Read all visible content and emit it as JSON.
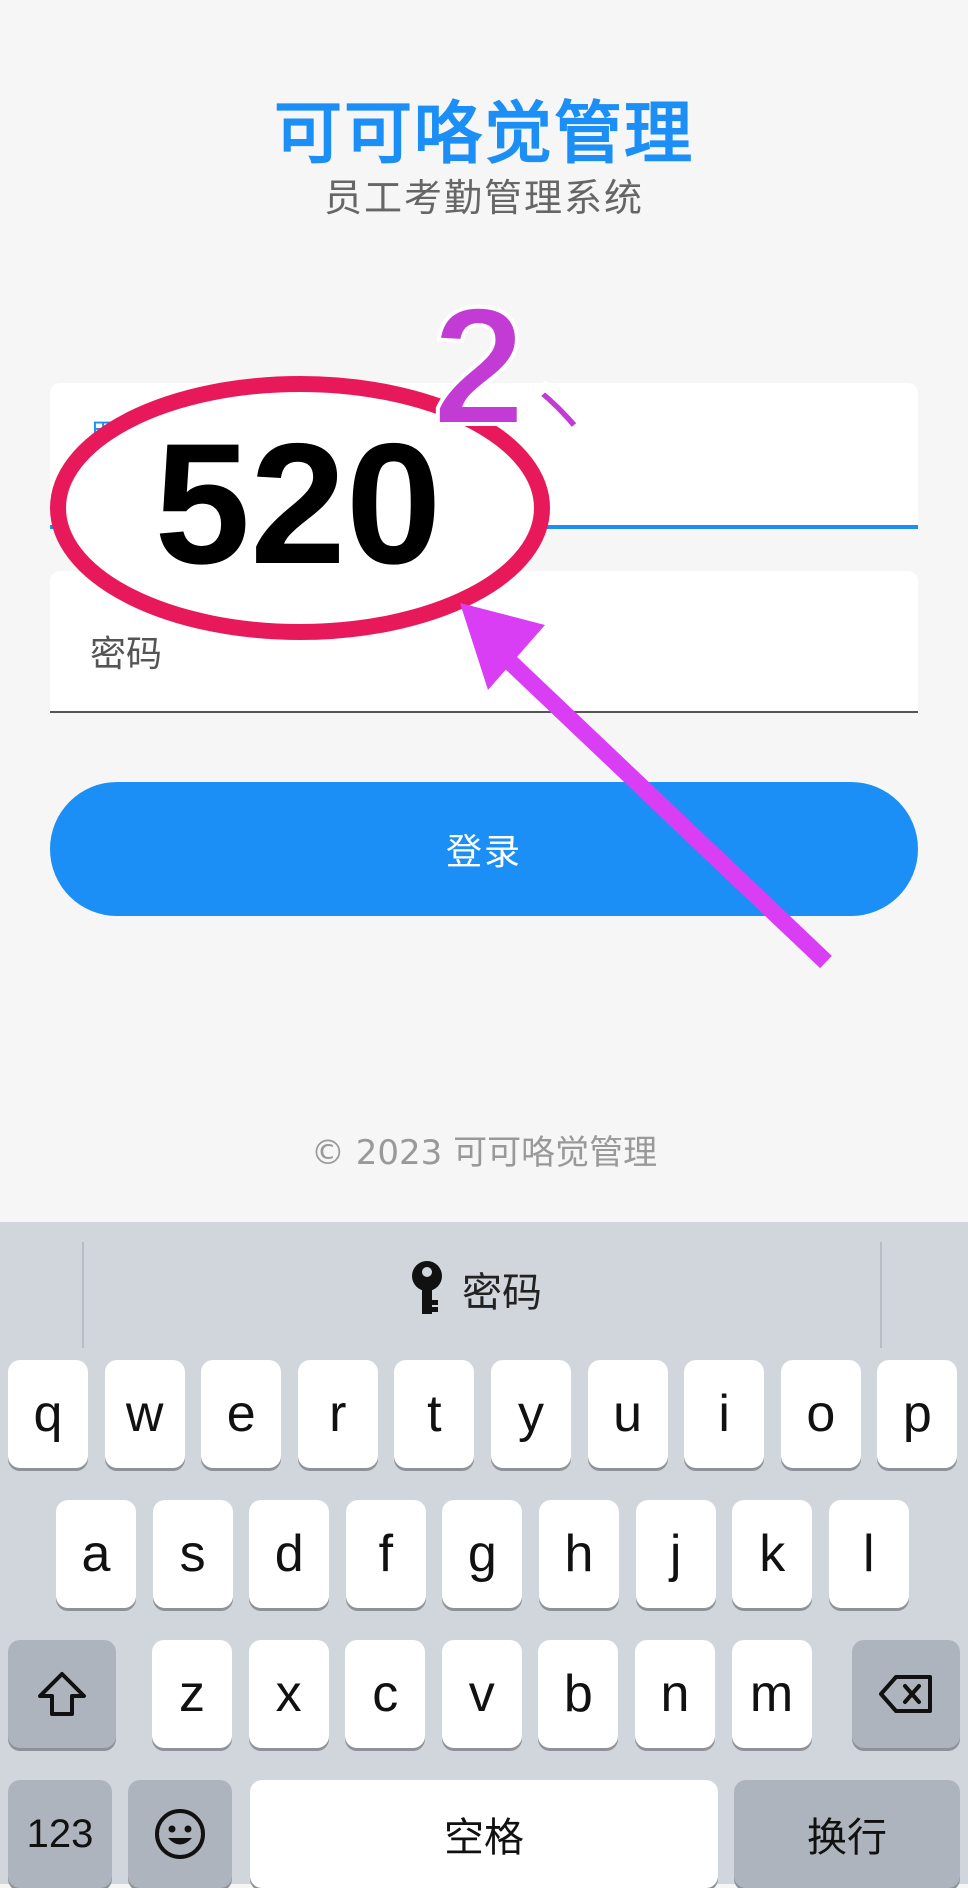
{
  "app": {
    "title": "可可咯觉管理",
    "subtitle": "员工考勤管理系统"
  },
  "form": {
    "username_label": "用",
    "password_label": "密码",
    "login_label": "登录"
  },
  "footer": {
    "text": "© 2023 可可咯觉管理"
  },
  "annotation": {
    "circled_number": "520",
    "step_label": "2、",
    "circle_color": "#e8195a",
    "arrow_color": "#d93ef5"
  },
  "keyboard": {
    "suggestion": {
      "icon": "key-icon",
      "label": "密码"
    },
    "row1": [
      "q",
      "w",
      "e",
      "r",
      "t",
      "y",
      "u",
      "i",
      "o",
      "p"
    ],
    "row2": [
      "a",
      "s",
      "d",
      "f",
      "g",
      "h",
      "j",
      "k",
      "l"
    ],
    "row3": [
      "z",
      "x",
      "c",
      "v",
      "b",
      "n",
      "m"
    ],
    "shift_icon": "shift-icon",
    "delete_icon": "delete-icon",
    "numbers_label": "123",
    "emoji_icon": "emoji-icon",
    "space_label": "空格",
    "return_label": "换行"
  },
  "colors": {
    "accent": "#1b8ff5",
    "background": "#f6f6f6",
    "keyboard_bg": "#d1d5dc"
  }
}
